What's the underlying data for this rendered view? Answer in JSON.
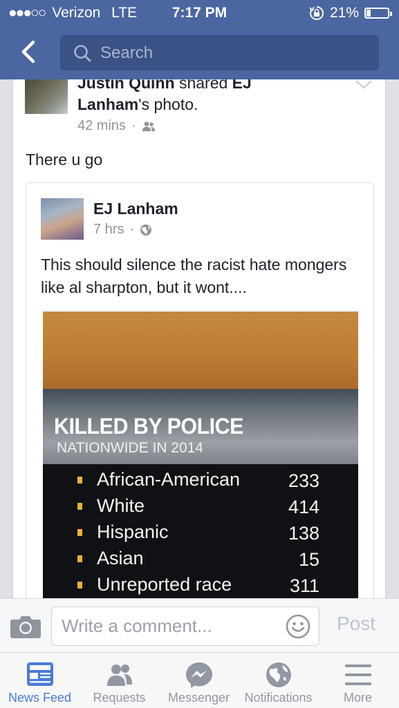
{
  "status_bar": {
    "carrier": "Verizon",
    "network": "LTE",
    "time": "7:17 PM",
    "battery_percent": "21%",
    "battery_level": 0.21,
    "signal_bars_filled": 3,
    "signal_bars_total": 5
  },
  "nav": {
    "search_placeholder": "Search"
  },
  "post": {
    "author": "Justin Quinn",
    "shared_text": " shared ",
    "original_author": "EJ Lanham",
    "object": "'s photo.",
    "time": "42 mins",
    "audience_icon": "friends-icon",
    "caption": "There u go",
    "shared": {
      "author": "EJ Lanham",
      "time": "7 hrs",
      "audience_icon": "globe-icon",
      "text": "This should silence the racist hate mongers like al sharpton, but it wont....",
      "photo": {
        "title": "KILLED BY POLICE",
        "subtitle": "NATIONWIDE IN 2014",
        "rows": [
          {
            "label": "African-American",
            "value": "233"
          },
          {
            "label": "White",
            "value": "414"
          },
          {
            "label": "Hispanic",
            "value": "138"
          },
          {
            "label": "Asian",
            "value": "15"
          },
          {
            "label": "Unreported race",
            "value": "311"
          }
        ]
      }
    }
  },
  "comment_bar": {
    "placeholder": "Write a comment...",
    "post_label": "Post"
  },
  "tabs": [
    {
      "label": "News Feed",
      "icon": "news-feed-icon",
      "active": true
    },
    {
      "label": "Requests",
      "icon": "requests-icon",
      "active": false
    },
    {
      "label": "Messenger",
      "icon": "messenger-icon",
      "active": false
    },
    {
      "label": "Notifications",
      "icon": "notifications-icon",
      "active": false
    },
    {
      "label": "More",
      "icon": "more-icon",
      "active": false
    }
  ],
  "colors": {
    "header": "#4b66a0",
    "active_tab": "#4b7bd6",
    "inactive_tab": "#9197a3"
  }
}
